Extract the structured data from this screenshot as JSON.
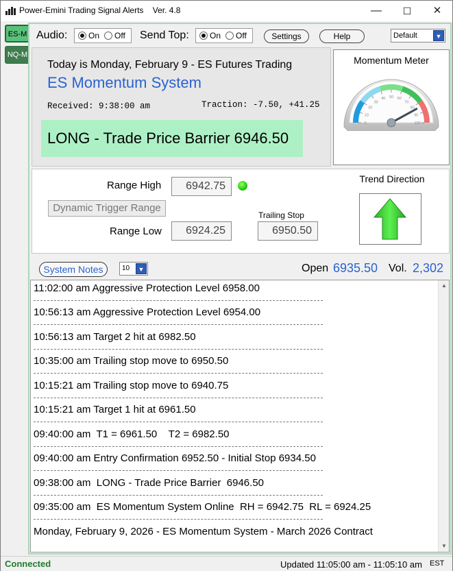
{
  "window": {
    "title": "Power-Emini Trading Signal Alerts    Ver. 4.8"
  },
  "window_controls": {
    "minimize": "—",
    "maximize": "☐",
    "close": "✕"
  },
  "side_tabs": [
    {
      "label": "ES-M"
    },
    {
      "label": "NQ-M"
    }
  ],
  "controls": {
    "audio_label": "Audio:",
    "audio_on": "On",
    "audio_off": "Off",
    "audio_selected": "On",
    "send_top_label": "Send Top:",
    "send_top_on": "On",
    "send_top_off": "Off",
    "send_top_selected": "On",
    "settings_label": "Settings",
    "help_label": "Help",
    "profile_value": "Default"
  },
  "info": {
    "today": "Today is Monday, February 9 - ES Futures Trading",
    "system_name": "ES Momentum System",
    "received": "Received: 9:38:00 am",
    "traction": "Traction: -7.50, +41.25",
    "signal": "LONG - Trade Price Barrier  6946.50"
  },
  "meter": {
    "title": "Momentum Meter",
    "ticks": [
      "0",
      "10",
      "20",
      "30",
      "40",
      "50",
      "60",
      "70",
      "80",
      "90",
      "100"
    ],
    "value": 84
  },
  "range": {
    "high_label": "Range High",
    "high_value": "6942.75",
    "dynamic_trigger_label": "Dynamic Trigger Range",
    "low_label": "Range Low",
    "low_value": "6924.25",
    "trailing_stop_label": "Trailing Stop",
    "trailing_stop_value": "6950.50"
  },
  "trend": {
    "title": "Trend Direction",
    "direction": "up",
    "arrow_color": "#3ecf3a"
  },
  "notes_header": {
    "system_notes_label": "System Notes",
    "count_value": "10",
    "open_label": "Open",
    "open_value": "6935.50",
    "vol_label": "Vol.",
    "vol_value": "2,302"
  },
  "notes": [
    "11:02:00 am  Aggressive Protection Level  6958.00",
    "10:56:13 am  Aggressive Protection Level  6954.00",
    "10:56:13 am  Target 2 hit at 6982.50",
    "10:35:00 am  Trailing stop move to 6950.50",
    "10:15:21 am  Trailing stop move to 6940.75",
    "10:15:21 am  Target 1 hit at 6961.50",
    "09:40:00 am  T1 = 6961.50    T2 = 6982.50",
    "09:40:00 am  Entry Confirmation 6952.50 - Initial Stop 6934.50",
    "09:38:00 am  LONG - Trade Price Barrier  6946.50",
    "09:35:00 am  ES Momentum System Online  RH = 6942.75  RL = 6924.25",
    "Monday, February 9, 2026 - ES Momentum System - March 2026 Contract"
  ],
  "status": {
    "connection": "Connected",
    "updated": "Updated 11:05:00 am - 11:05:10 am",
    "timezone": "EST"
  },
  "colors": {
    "accent_blue": "#2b62d0",
    "signal_bg": "#aef0c6",
    "connected_green": "#1e7d2a",
    "tab_active": "#5ac17a"
  }
}
